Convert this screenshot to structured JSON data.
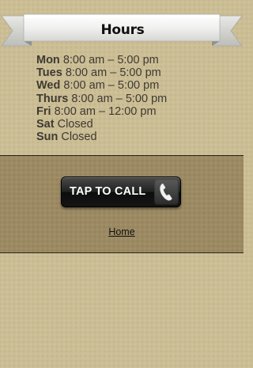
{
  "banner": {
    "title": "Hours"
  },
  "hours": [
    {
      "day": "Mon",
      "time": "8:00 am – 5:00 pm"
    },
    {
      "day": "Tues",
      "time": "8:00 am – 5:00 pm"
    },
    {
      "day": "Wed",
      "time": "8:00 am – 5:00 pm"
    },
    {
      "day": "Thurs",
      "time": "8:00 am – 5:00 pm"
    },
    {
      "day": "Fri",
      "time": "8:00 am – 12:00 pm"
    },
    {
      "day": "Sat",
      "time": "Closed"
    },
    {
      "day": "Sun",
      "time": "Closed"
    }
  ],
  "call_button": {
    "label": "TAP TO CALL",
    "icon": "phone-icon"
  },
  "footer": {
    "home_link": "Home"
  },
  "colors": {
    "page_background": "#cbbd94",
    "band_background": "#9c8a63",
    "button_background": "#151515",
    "text": "#3e3a32"
  }
}
